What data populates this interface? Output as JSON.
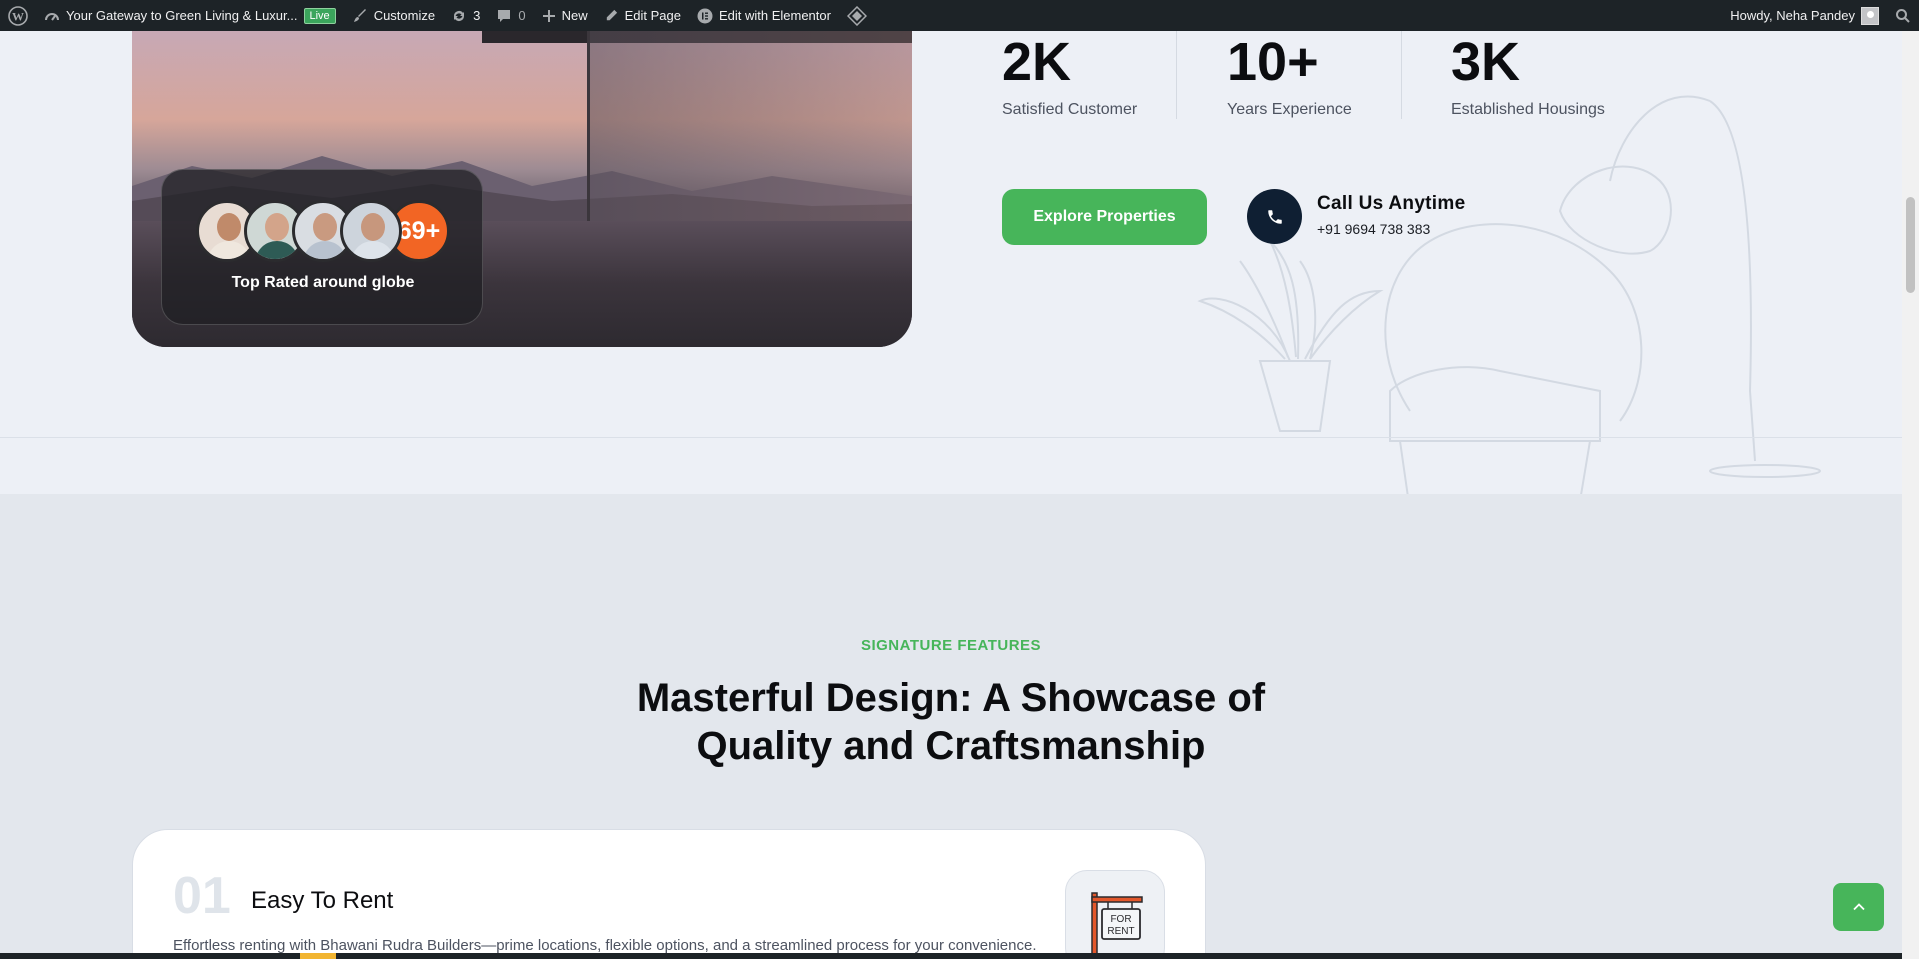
{
  "adminbar": {
    "site_title": "Your Gateway to Green Living & Luxur...",
    "live_badge": "Live",
    "customize": "Customize",
    "updates_count": "3",
    "comments_count": "0",
    "new": "New",
    "edit_page": "Edit Page",
    "edit_elementor": "Edit with Elementor",
    "howdy": "Howdy, Neha Pandey"
  },
  "hero": {
    "rated_count": "69+",
    "rated_label": "Top Rated around globe",
    "stats": [
      {
        "value": "2K",
        "label": "Satisfied Customer"
      },
      {
        "value": "10+",
        "label": "Years Experience"
      },
      {
        "value": "3K",
        "label": "Established Housings"
      }
    ],
    "explore_button": "Explore Properties",
    "call_title": "Call Us Anytime",
    "call_number": "+91 9694 738 383"
  },
  "features": {
    "eyebrow": "SIGNATURE FEATURES",
    "heading_line1": "Masterful Design: A Showcase of",
    "heading_line2": "Quality and Craftsmanship",
    "card": {
      "number": "01",
      "title": "Easy To Rent",
      "description": "Effortless renting with Bhawani Rudra Builders—prime locations, flexible options, and a streamlined process for your convenience.",
      "icon": "for-rent-sign-icon",
      "sign_line1": "FOR",
      "sign_line2": "RENT"
    }
  },
  "colors": {
    "accent_green": "#47b55a",
    "badge_orange": "#f26524",
    "phone_navy": "#0f1f33",
    "adminbar": "#1d2327"
  }
}
